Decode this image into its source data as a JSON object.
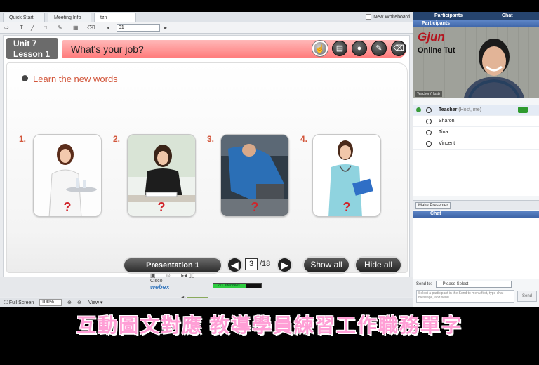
{
  "tabs": [
    {
      "label": "Quick Start"
    },
    {
      "label": "Meeting Info"
    },
    {
      "label": "tzn"
    }
  ],
  "new_whiteboard": "New Whiteboard",
  "toolbar": {
    "page_field": "01"
  },
  "slide": {
    "unit": "Unit 7",
    "lesson": "Lesson 1",
    "title": "What's your job?",
    "section": "Learn the new words",
    "cards": [
      {
        "num": "1.",
        "qmark": "?"
      },
      {
        "num": "2.",
        "qmark": "?"
      },
      {
        "num": "3.",
        "qmark": "?"
      },
      {
        "num": "4.",
        "qmark": "?"
      }
    ],
    "presentation_label": "Presentation 1",
    "current_page": "3",
    "total_pages": "/18",
    "show_all": "Show all",
    "hide_all": "Hide all"
  },
  "meeting_controls": {
    "attendees": "221 attendees",
    "cisco": "Cisco",
    "webex": "webex"
  },
  "statusbar": {
    "full_screen": "Full Screen",
    "zoom": "100%",
    "view": "View"
  },
  "right_panel": {
    "tab_participants": "Participants",
    "tab_chat": "Chat",
    "participants_header": "Participants",
    "video": {
      "logo": "Gjun",
      "logo_sub": "Online Tut",
      "label": "Teacher (Host)"
    },
    "participants": [
      {
        "name": "Teacher",
        "note": "(Host, me)"
      },
      {
        "name": "Sharon",
        "note": ""
      },
      {
        "name": "Tina",
        "note": ""
      },
      {
        "name": "Vincent",
        "note": ""
      }
    ],
    "make_presenter": "Make Presenter",
    "chat_header": "Chat",
    "send_to_label": "Send to:",
    "send_to_value": "-- Please Select --",
    "chat_placeholder": "Select a participant in the Send to menu first, type chat message, and send...",
    "send": "Send"
  },
  "caption": "互動圖文對應 教導學員練習工作職務單字",
  "colors": {
    "accent_red": "#d2563b",
    "title_band": "#ff7a7a",
    "panel_blue": "#3d64a7",
    "caption_pink": "#ff9fd6"
  }
}
